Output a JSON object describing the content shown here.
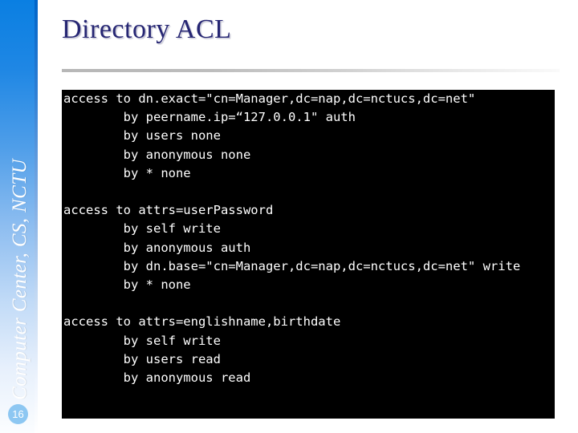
{
  "sidebar": {
    "vertical_text": "Computer Center, CS, NCTU",
    "page_number": "16",
    "accent_top": "#0a7fe2",
    "accent_bottom": "#fbfdff",
    "badge_color": "#8dc7f2"
  },
  "header": {
    "title": "Directory ACL",
    "title_color": "#262673",
    "rule_color": "#bdbdbd"
  },
  "code_block": {
    "background": "#000000",
    "foreground": "#ffffff",
    "lines": [
      "access to dn.exact=\"cn=Manager,dc=nap,dc=nctucs,dc=net\"",
      "        by peername.ip=“127.0.0.1\" auth",
      "        by users none",
      "        by anonymous none",
      "        by * none",
      "",
      "access to attrs=userPassword",
      "        by self write",
      "        by anonymous auth",
      "        by dn.base=\"cn=Manager,dc=nap,dc=nctucs,dc=net\" write",
      "        by * none",
      "",
      "access to attrs=englishname,birthdate",
      "        by self write",
      "        by users read",
      "        by anonymous read"
    ]
  }
}
